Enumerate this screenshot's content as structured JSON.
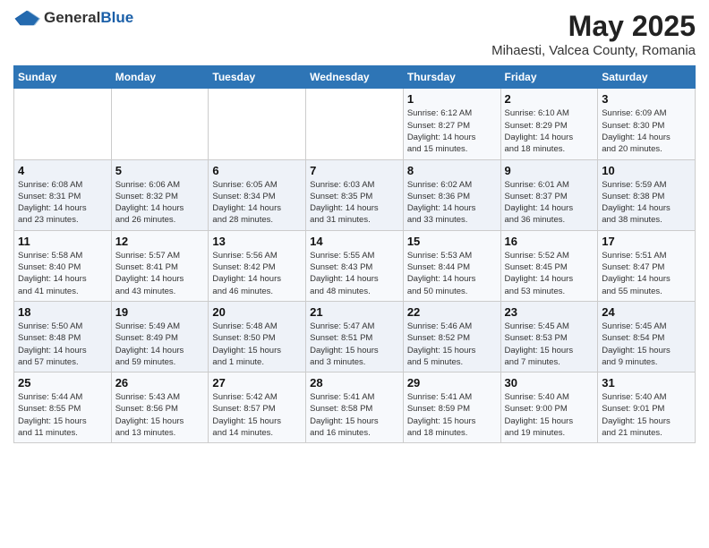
{
  "logo": {
    "general": "General",
    "blue": "Blue"
  },
  "title": "May 2025",
  "location": "Mihaesti, Valcea County, Romania",
  "days_header": [
    "Sunday",
    "Monday",
    "Tuesday",
    "Wednesday",
    "Thursday",
    "Friday",
    "Saturday"
  ],
  "weeks": [
    [
      {
        "day": "",
        "info": ""
      },
      {
        "day": "",
        "info": ""
      },
      {
        "day": "",
        "info": ""
      },
      {
        "day": "",
        "info": ""
      },
      {
        "day": "1",
        "info": "Sunrise: 6:12 AM\nSunset: 8:27 PM\nDaylight: 14 hours\nand 15 minutes."
      },
      {
        "day": "2",
        "info": "Sunrise: 6:10 AM\nSunset: 8:29 PM\nDaylight: 14 hours\nand 18 minutes."
      },
      {
        "day": "3",
        "info": "Sunrise: 6:09 AM\nSunset: 8:30 PM\nDaylight: 14 hours\nand 20 minutes."
      }
    ],
    [
      {
        "day": "4",
        "info": "Sunrise: 6:08 AM\nSunset: 8:31 PM\nDaylight: 14 hours\nand 23 minutes."
      },
      {
        "day": "5",
        "info": "Sunrise: 6:06 AM\nSunset: 8:32 PM\nDaylight: 14 hours\nand 26 minutes."
      },
      {
        "day": "6",
        "info": "Sunrise: 6:05 AM\nSunset: 8:34 PM\nDaylight: 14 hours\nand 28 minutes."
      },
      {
        "day": "7",
        "info": "Sunrise: 6:03 AM\nSunset: 8:35 PM\nDaylight: 14 hours\nand 31 minutes."
      },
      {
        "day": "8",
        "info": "Sunrise: 6:02 AM\nSunset: 8:36 PM\nDaylight: 14 hours\nand 33 minutes."
      },
      {
        "day": "9",
        "info": "Sunrise: 6:01 AM\nSunset: 8:37 PM\nDaylight: 14 hours\nand 36 minutes."
      },
      {
        "day": "10",
        "info": "Sunrise: 5:59 AM\nSunset: 8:38 PM\nDaylight: 14 hours\nand 38 minutes."
      }
    ],
    [
      {
        "day": "11",
        "info": "Sunrise: 5:58 AM\nSunset: 8:40 PM\nDaylight: 14 hours\nand 41 minutes."
      },
      {
        "day": "12",
        "info": "Sunrise: 5:57 AM\nSunset: 8:41 PM\nDaylight: 14 hours\nand 43 minutes."
      },
      {
        "day": "13",
        "info": "Sunrise: 5:56 AM\nSunset: 8:42 PM\nDaylight: 14 hours\nand 46 minutes."
      },
      {
        "day": "14",
        "info": "Sunrise: 5:55 AM\nSunset: 8:43 PM\nDaylight: 14 hours\nand 48 minutes."
      },
      {
        "day": "15",
        "info": "Sunrise: 5:53 AM\nSunset: 8:44 PM\nDaylight: 14 hours\nand 50 minutes."
      },
      {
        "day": "16",
        "info": "Sunrise: 5:52 AM\nSunset: 8:45 PM\nDaylight: 14 hours\nand 53 minutes."
      },
      {
        "day": "17",
        "info": "Sunrise: 5:51 AM\nSunset: 8:47 PM\nDaylight: 14 hours\nand 55 minutes."
      }
    ],
    [
      {
        "day": "18",
        "info": "Sunrise: 5:50 AM\nSunset: 8:48 PM\nDaylight: 14 hours\nand 57 minutes."
      },
      {
        "day": "19",
        "info": "Sunrise: 5:49 AM\nSunset: 8:49 PM\nDaylight: 14 hours\nand 59 minutes."
      },
      {
        "day": "20",
        "info": "Sunrise: 5:48 AM\nSunset: 8:50 PM\nDaylight: 15 hours\nand 1 minute."
      },
      {
        "day": "21",
        "info": "Sunrise: 5:47 AM\nSunset: 8:51 PM\nDaylight: 15 hours\nand 3 minutes."
      },
      {
        "day": "22",
        "info": "Sunrise: 5:46 AM\nSunset: 8:52 PM\nDaylight: 15 hours\nand 5 minutes."
      },
      {
        "day": "23",
        "info": "Sunrise: 5:45 AM\nSunset: 8:53 PM\nDaylight: 15 hours\nand 7 minutes."
      },
      {
        "day": "24",
        "info": "Sunrise: 5:45 AM\nSunset: 8:54 PM\nDaylight: 15 hours\nand 9 minutes."
      }
    ],
    [
      {
        "day": "25",
        "info": "Sunrise: 5:44 AM\nSunset: 8:55 PM\nDaylight: 15 hours\nand 11 minutes."
      },
      {
        "day": "26",
        "info": "Sunrise: 5:43 AM\nSunset: 8:56 PM\nDaylight: 15 hours\nand 13 minutes."
      },
      {
        "day": "27",
        "info": "Sunrise: 5:42 AM\nSunset: 8:57 PM\nDaylight: 15 hours\nand 14 minutes."
      },
      {
        "day": "28",
        "info": "Sunrise: 5:41 AM\nSunset: 8:58 PM\nDaylight: 15 hours\nand 16 minutes."
      },
      {
        "day": "29",
        "info": "Sunrise: 5:41 AM\nSunset: 8:59 PM\nDaylight: 15 hours\nand 18 minutes."
      },
      {
        "day": "30",
        "info": "Sunrise: 5:40 AM\nSunset: 9:00 PM\nDaylight: 15 hours\nand 19 minutes."
      },
      {
        "day": "31",
        "info": "Sunrise: 5:40 AM\nSunset: 9:01 PM\nDaylight: 15 hours\nand 21 minutes."
      }
    ]
  ]
}
